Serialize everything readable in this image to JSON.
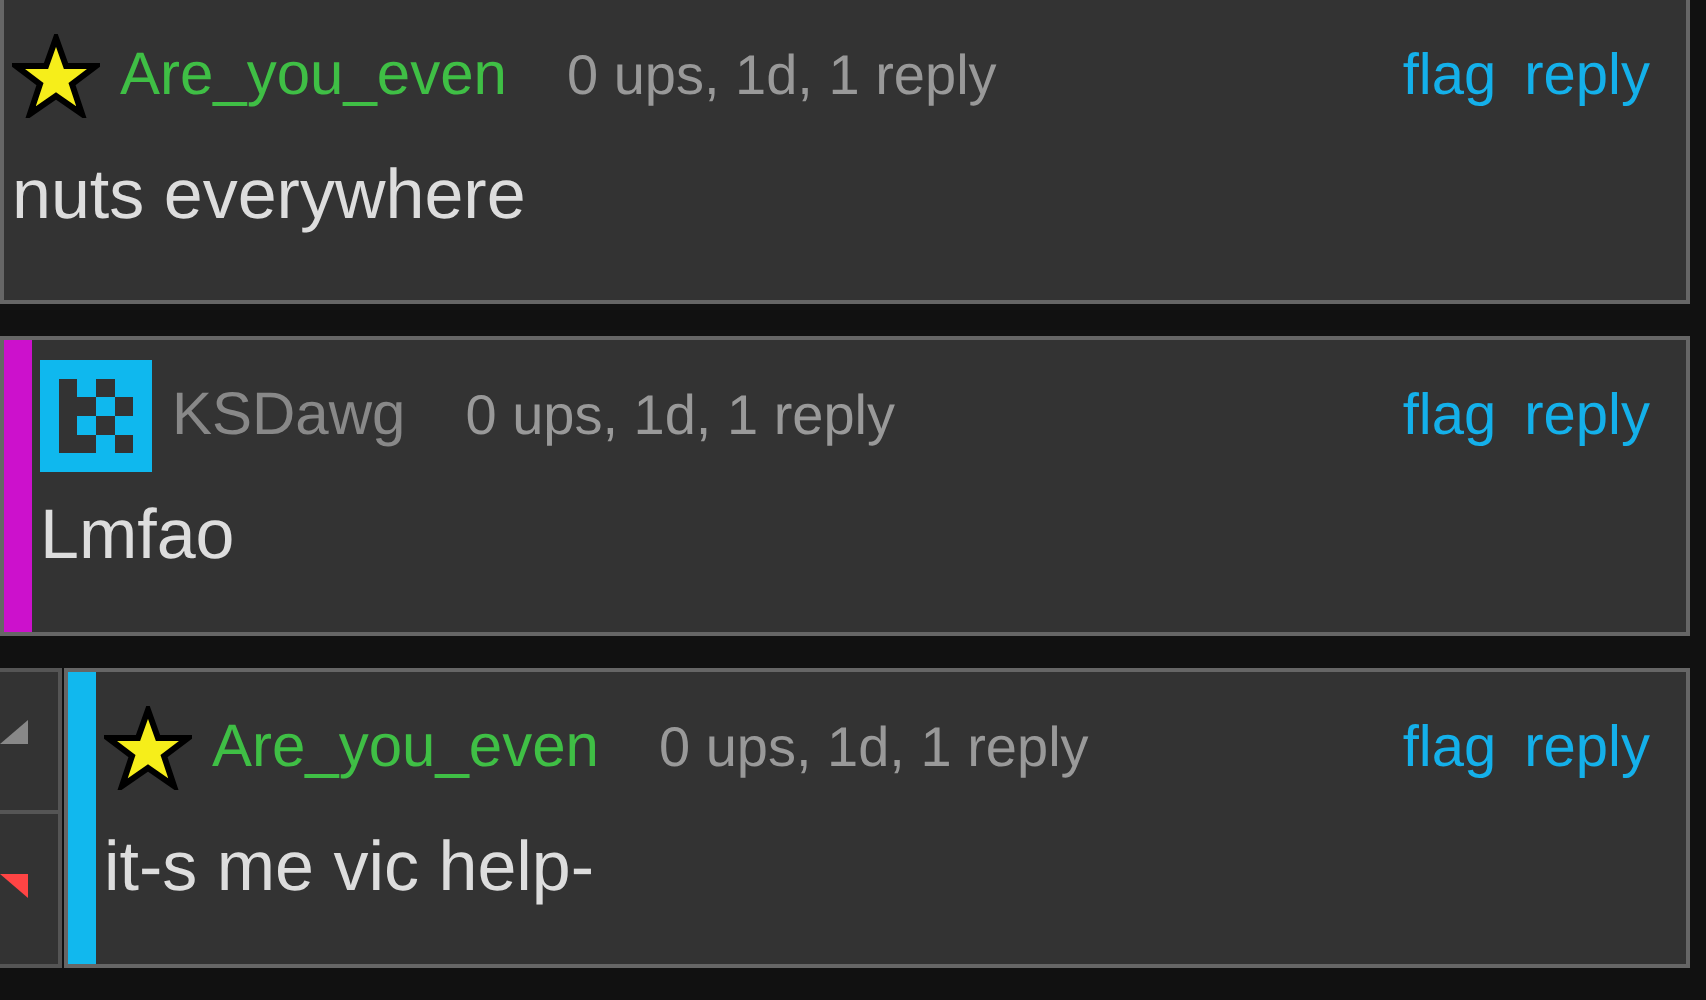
{
  "comments": [
    {
      "kind": "star",
      "user": "Are_you_even",
      "meta": "0 ups, 1d, 1 reply",
      "actions": [
        "flag",
        "reply"
      ],
      "text": "nuts everywhere"
    },
    {
      "kind": "pixel",
      "color": "#cc11cc",
      "user": "KSDawg",
      "meta": "0 ups, 1d, 1 reply",
      "actions": [
        "flag",
        "reply"
      ],
      "text": "Lmfao"
    },
    {
      "kind": "star",
      "color": "#11b8ee",
      "voting": true,
      "upvoted": false,
      "downvoted": true,
      "user": "Are_you_even",
      "meta": "0 ups, 1d, 1 reply",
      "actions": [
        "flag",
        "reply"
      ],
      "text": "it-s me vic help-"
    }
  ]
}
